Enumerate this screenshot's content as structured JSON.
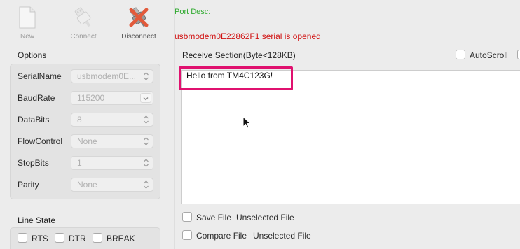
{
  "toolbar": {
    "new_label": "New",
    "connect_label": "Connect",
    "disconnect_label": "Disconnect"
  },
  "port_desc": "Port Desc:",
  "status_message": "usbmodem0E22862F1 serial is opened",
  "options": {
    "title": "Options",
    "rows": [
      {
        "label": "SerialName",
        "value": "usbmodem0E..."
      },
      {
        "label": "BaudRate",
        "value": "115200"
      },
      {
        "label": "DataBits",
        "value": "8"
      },
      {
        "label": "FlowControl",
        "value": "None"
      },
      {
        "label": "StopBits",
        "value": "1"
      },
      {
        "label": "Parity",
        "value": "None"
      }
    ]
  },
  "line_state": {
    "title": "Line State",
    "rts": "RTS",
    "dtr": "DTR",
    "break": "BREAK"
  },
  "receive": {
    "title": "Receive Section(Byte<128KB)",
    "autoscroll": "AutoScroll",
    "content": "Hello from TM4C123G!"
  },
  "save_file": {
    "label": "Save File",
    "value": "Unselected File"
  },
  "compare_file": {
    "label": "Compare File",
    "value": "Unselected File"
  },
  "colors": {
    "status_red": "#d11313",
    "port_desc_green": "#2faa2f",
    "highlight_pink": "#e0116f"
  }
}
